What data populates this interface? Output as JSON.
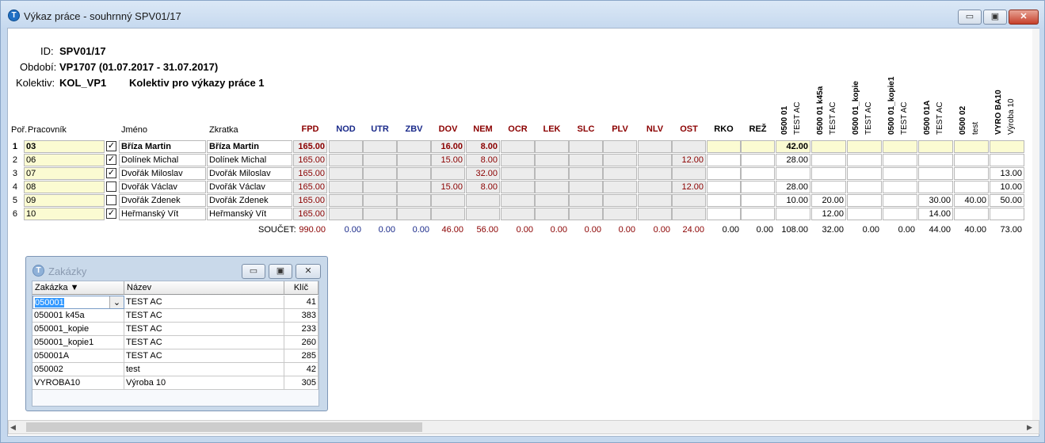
{
  "window": {
    "title": "Výkaz práce - souhrnný SPV01/17",
    "minimize": "▭",
    "maximize": "▣",
    "close": "✕"
  },
  "info": {
    "id_label": "ID:",
    "id_value": "SPV01/17",
    "period_label": "Období:",
    "period_value": "VP1707 (01.07.2017 - 31.07.2017)",
    "collective_label": "Kolektiv:",
    "collective_code": "KOL_VP1",
    "collective_name": "Kolektiv pro výkazy práce 1"
  },
  "headers": {
    "por": "Poř.",
    "pracovnik": "Pracovník",
    "jmeno": "Jméno",
    "zkratka": "Zkratka"
  },
  "codes": [
    {
      "label": "FPD",
      "color": "#8b0000"
    },
    {
      "label": "NOD",
      "color": "#1a2a8a"
    },
    {
      "label": "UTR",
      "color": "#1a2a8a"
    },
    {
      "label": "ZBV",
      "color": "#1a2a8a"
    },
    {
      "label": "DOV",
      "color": "#8b0000"
    },
    {
      "label": "NEM",
      "color": "#8b0000"
    },
    {
      "label": "OCR",
      "color": "#8b0000"
    },
    {
      "label": "LEK",
      "color": "#8b0000"
    },
    {
      "label": "SLC",
      "color": "#8b0000"
    },
    {
      "label": "PLV",
      "color": "#8b0000"
    },
    {
      "label": "NLV",
      "color": "#8b0000"
    },
    {
      "label": "OST",
      "color": "#8b0000"
    },
    {
      "label": "RKO",
      "color": "#000000"
    },
    {
      "label": "REŽ",
      "color": "#000000"
    }
  ],
  "orders": [
    {
      "code": "0500 01",
      "name": "TEST AC"
    },
    {
      "code": "0500 01 k45a",
      "name": "TEST AC"
    },
    {
      "code": "0500 01_kopie",
      "name": "TEST AC"
    },
    {
      "code": "0500 01_kopie1",
      "name": "TEST AC"
    },
    {
      "code": "0500 01A",
      "name": "TEST AC"
    },
    {
      "code": "0500 02",
      "name": "test"
    },
    {
      "code": "VYRO BA10",
      "name": "Výroba 10"
    }
  ],
  "rows": [
    {
      "n": "1",
      "worker": "03",
      "checked": true,
      "name": "Bříza Martin",
      "short": "Bříza Martin",
      "bold": true,
      "codes": [
        "165.00",
        "",
        "",
        "",
        "16.00",
        "8.00",
        "",
        "",
        "",
        "",
        "",
        "",
        "",
        ""
      ],
      "orders": [
        "42.00",
        "",
        "",
        "",
        "",
        "",
        ""
      ]
    },
    {
      "n": "2",
      "worker": "06",
      "checked": true,
      "name": "Dolínek Michal",
      "short": "Dolínek Michal",
      "bold": false,
      "codes": [
        "165.00",
        "",
        "",
        "",
        "15.00",
        "8.00",
        "",
        "",
        "",
        "",
        "",
        "12.00",
        "",
        ""
      ],
      "orders": [
        "28.00",
        "",
        "",
        "",
        "",
        "",
        ""
      ]
    },
    {
      "n": "3",
      "worker": "07",
      "checked": true,
      "name": "Dvořák Miloslav",
      "short": "Dvořák Miloslav",
      "bold": false,
      "codes": [
        "165.00",
        "",
        "",
        "",
        "",
        "32.00",
        "",
        "",
        "",
        "",
        "",
        "",
        "",
        ""
      ],
      "orders": [
        "",
        "",
        "",
        "",
        "",
        "",
        "13.00"
      ]
    },
    {
      "n": "4",
      "worker": "08",
      "checked": false,
      "name": "Dvořák Václav",
      "short": "Dvořák Václav",
      "bold": false,
      "codes": [
        "165.00",
        "",
        "",
        "",
        "15.00",
        "8.00",
        "",
        "",
        "",
        "",
        "",
        "12.00",
        "",
        ""
      ],
      "orders": [
        "28.00",
        "",
        "",
        "",
        "",
        "",
        "10.00"
      ]
    },
    {
      "n": "5",
      "worker": "09",
      "checked": false,
      "name": "Dvořák Zdenek",
      "short": "Dvořák Zdenek",
      "bold": false,
      "codes": [
        "165.00",
        "",
        "",
        "",
        "",
        "",
        "",
        "",
        "",
        "",
        "",
        "",
        "",
        ""
      ],
      "orders": [
        "10.00",
        "20.00",
        "",
        "",
        "30.00",
        "40.00",
        "50.00"
      ]
    },
    {
      "n": "6",
      "worker": "10",
      "checked": true,
      "name": "Heřmanský Vít",
      "short": "Heřmanský Vít",
      "bold": false,
      "codes": [
        "165.00",
        "",
        "",
        "",
        "",
        "",
        "",
        "",
        "",
        "",
        "",
        "",
        "",
        ""
      ],
      "orders": [
        "",
        "12.00",
        "",
        "",
        "14.00",
        "",
        ""
      ]
    }
  ],
  "sum": {
    "label": "SOUČET:",
    "codes": [
      "990.00",
      "0.00",
      "0.00",
      "0.00",
      "46.00",
      "56.00",
      "0.00",
      "0.00",
      "0.00",
      "0.00",
      "0.00",
      "24.00",
      "0.00",
      "0.00"
    ],
    "orders": [
      "108.00",
      "32.00",
      "0.00",
      "0.00",
      "44.00",
      "40.00",
      "73.00"
    ]
  },
  "zakazky": {
    "title": "Zakázky",
    "headers": [
      "Zakázka ▼",
      "Název",
      "Klíč"
    ],
    "dropdown": "⌄",
    "rows": [
      [
        "050001",
        "TEST AC",
        "41"
      ],
      [
        "050001 k45a",
        "TEST AC",
        "383"
      ],
      [
        "050001_kopie",
        "TEST AC",
        "233"
      ],
      [
        "050001_kopie1",
        "TEST AC",
        "260"
      ],
      [
        "050001A",
        "TEST AC",
        "285"
      ],
      [
        "050002",
        "test",
        "42"
      ],
      [
        "VYROBA10",
        "Výroba 10",
        "305"
      ]
    ]
  },
  "scroll": {
    "left": "◀",
    "right": "▶"
  }
}
